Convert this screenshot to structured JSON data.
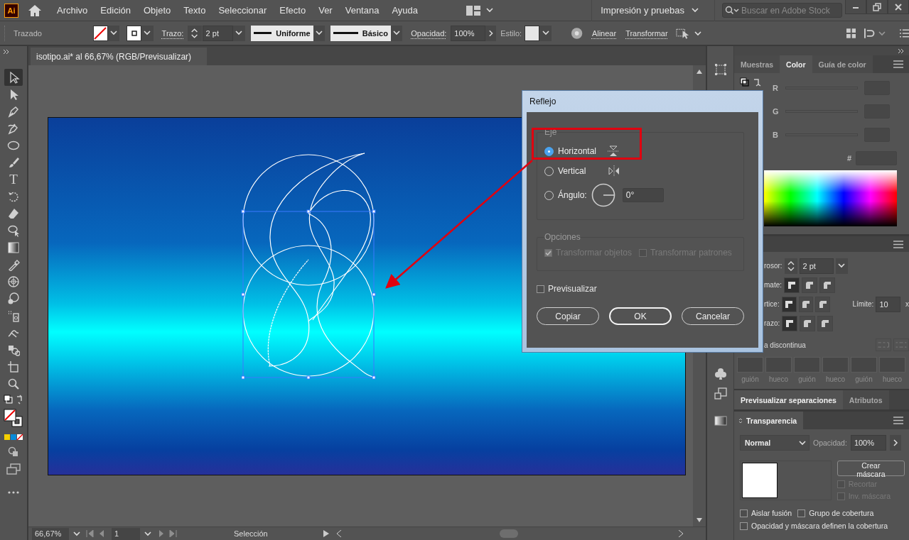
{
  "app": {
    "logo": "Ai"
  },
  "menu": [
    "Archivo",
    "Edición",
    "Objeto",
    "Texto",
    "Seleccionar",
    "Efecto",
    "Ver",
    "Ventana",
    "Ayuda"
  ],
  "workspace": "Impresión y pruebas",
  "search": {
    "placeholder": "Buscar en Adobe Stock"
  },
  "control_bar": {
    "selection": "Trazado",
    "stroke_label": "Trazo:",
    "stroke_weight": "2 pt",
    "profile": "Uniforme",
    "brush": "Básico",
    "opacity_label": "Opacidad:",
    "opacity": "100%",
    "style_label": "Estilo:",
    "align_link": "Alinear",
    "transform_link": "Transformar"
  },
  "tools": [
    {
      "kind": "select",
      "selected": true
    },
    {
      "kind": "direct",
      "selected": false
    },
    {
      "kind": "pen",
      "selected": false
    },
    {
      "kind": "curvature",
      "selected": false
    },
    {
      "kind": "ellipse",
      "selected": false
    },
    {
      "kind": "brush",
      "selected": false
    },
    {
      "kind": "type",
      "label": "T",
      "selected": false
    },
    {
      "kind": "rotate",
      "selected": false
    },
    {
      "kind": "eraser",
      "selected": false
    },
    {
      "kind": "lasso",
      "selected": false
    },
    {
      "kind": "gradient",
      "selected": false
    },
    {
      "kind": "eyedropper",
      "selected": false
    },
    {
      "kind": "blend",
      "selected": false
    },
    {
      "kind": "warp",
      "selected": false
    },
    {
      "kind": "spray",
      "selected": false
    },
    {
      "kind": "puppet",
      "selected": false
    },
    {
      "kind": "shapebuilder",
      "selected": false
    },
    {
      "kind": "artboard",
      "selected": false
    },
    {
      "kind": "zoom",
      "selected": false
    }
  ],
  "document_tab": {
    "title": "isotipo.ai* al 66,67% (RGB/Previsualizar)"
  },
  "status_bar": {
    "zoom": "66,67%",
    "artboard": "1",
    "tool": "Selección"
  },
  "dialog": {
    "title": "Reflejo",
    "axis_group": "Eje",
    "axis_options": [
      {
        "kind": "horizontal",
        "label": "Horizontal",
        "selected": true
      },
      {
        "kind": "vertical",
        "label": "Vertical",
        "selected": false
      },
      {
        "kind": "angle",
        "label": "Ángulo:",
        "selected": false
      }
    ],
    "angle": "0°",
    "options_group": "Opciones",
    "options": [
      {
        "label": "Transformar objetos",
        "checked": true,
        "disabled": true
      },
      {
        "label": "Transformar patrones",
        "checked": false,
        "disabled": true
      }
    ],
    "preview": {
      "label": "Previsualizar",
      "checked": false
    },
    "buttons": [
      {
        "label": "Copiar",
        "default": false
      },
      {
        "label": "OK",
        "default": true
      },
      {
        "label": "Cancelar",
        "default": false
      }
    ]
  },
  "color_panel": {
    "tabs": [
      {
        "label": "Muestras",
        "selected": false
      },
      {
        "label": "Color",
        "selected": true
      },
      {
        "label": "Guía de color",
        "selected": false
      }
    ],
    "channels": [
      "R",
      "G",
      "B"
    ],
    "hex_label": "#"
  },
  "stroke_panel": {
    "weight_label": "rosor:",
    "weight": "2 pt",
    "cap_label": "mate:",
    "caps": [
      {
        "selected": true
      },
      {
        "selected": false
      },
      {
        "selected": false
      }
    ],
    "corner_label": "rtice:",
    "corners": [
      {
        "selected": true
      },
      {
        "selected": false
      },
      {
        "selected": false
      }
    ],
    "limit_label": "Límite:",
    "limit": "10",
    "limit_unit": "x",
    "align_label": "razo:",
    "aligns": [
      {
        "selected": true
      },
      {
        "selected": false
      },
      {
        "selected": false
      }
    ],
    "dashed_label": "a discontinua",
    "dash_fields": [
      "guión",
      "hueco",
      "guión",
      "hueco",
      "guión",
      "hueco"
    ]
  },
  "bottom_tabs": [
    {
      "label": "Previsualizar separaciones",
      "selected": true
    },
    {
      "label": "Atributos",
      "selected": false
    }
  ],
  "transparency_panel": {
    "title": "Transparencia",
    "blend_mode": "Normal",
    "opacity_label": "Opacidad:",
    "opacity": "100%",
    "mask_button": "Crear máscara",
    "mask_options": [
      {
        "label": "Recortar",
        "checked": false,
        "disabled": true
      },
      {
        "label": "Inv. máscara",
        "checked": false,
        "disabled": true
      }
    ],
    "options": [
      {
        "label": "Aislar fusión",
        "checked": false
      },
      {
        "label": "Grupo de cobertura",
        "checked": false
      },
      {
        "label": "Opacidad y máscara definen la cobertura",
        "checked": false
      }
    ]
  }
}
